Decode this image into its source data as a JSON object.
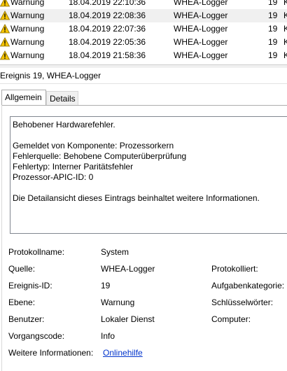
{
  "events": [
    {
      "level": "Warnung",
      "date": "18.04.2019 22:10:36",
      "source": "WHEA-Logger",
      "id": "19",
      "task": "K"
    },
    {
      "level": "Warnung",
      "date": "18.04.2019 22:08:36",
      "source": "WHEA-Logger",
      "id": "19",
      "task": "K"
    },
    {
      "level": "Warnung",
      "date": "18.04.2019 22:07:36",
      "source": "WHEA-Logger",
      "id": "19",
      "task": "K"
    },
    {
      "level": "Warnung",
      "date": "18.04.2019 22:05:36",
      "source": "WHEA-Logger",
      "id": "19",
      "task": "K"
    },
    {
      "level": "Warnung",
      "date": "18.04.2019 21:58:36",
      "source": "WHEA-Logger",
      "id": "19",
      "task": "K"
    }
  ],
  "detail": {
    "title": "Ereignis 19, WHEA-Logger",
    "tabs": {
      "general": "Allgemein",
      "details": "Details"
    },
    "description": [
      "Behobener Hardwarefehler.",
      "Gemeldet von Komponente: Prozessorkern",
      "Fehlerquelle: Behobene Computerüberprüfung",
      "Fehlertyp: Interner Paritätsfehler",
      "Prozessor-APIC-ID: 0",
      "Die Detailansicht dieses Eintrags beinhaltet weitere Informationen."
    ],
    "props": {
      "log_name_label": "Protokollname:",
      "log_name_value": "System",
      "source_label": "Quelle:",
      "source_value": "WHEA-Logger",
      "logged_label": "Protokolliert:",
      "event_id_label": "Ereignis-ID:",
      "event_id_value": "19",
      "task_category_label": "Aufgabenkategorie:",
      "level_label": "Ebene:",
      "level_value": "Warnung",
      "keywords_label": "Schlüsselwörter:",
      "user_label": "Benutzer:",
      "user_value": "Lokaler Dienst",
      "computer_label": "Computer:",
      "opcode_label": "Vorgangscode:",
      "opcode_value": "Info",
      "more_info_label": "Weitere Informationen:",
      "more_info_link": "Onlinehilfe"
    }
  },
  "colors": {
    "warning_icon": "#f5c400",
    "link": "#0033cc",
    "row_alt": "#f0f0f0"
  },
  "icons": {
    "event_level": "warning-icon"
  }
}
